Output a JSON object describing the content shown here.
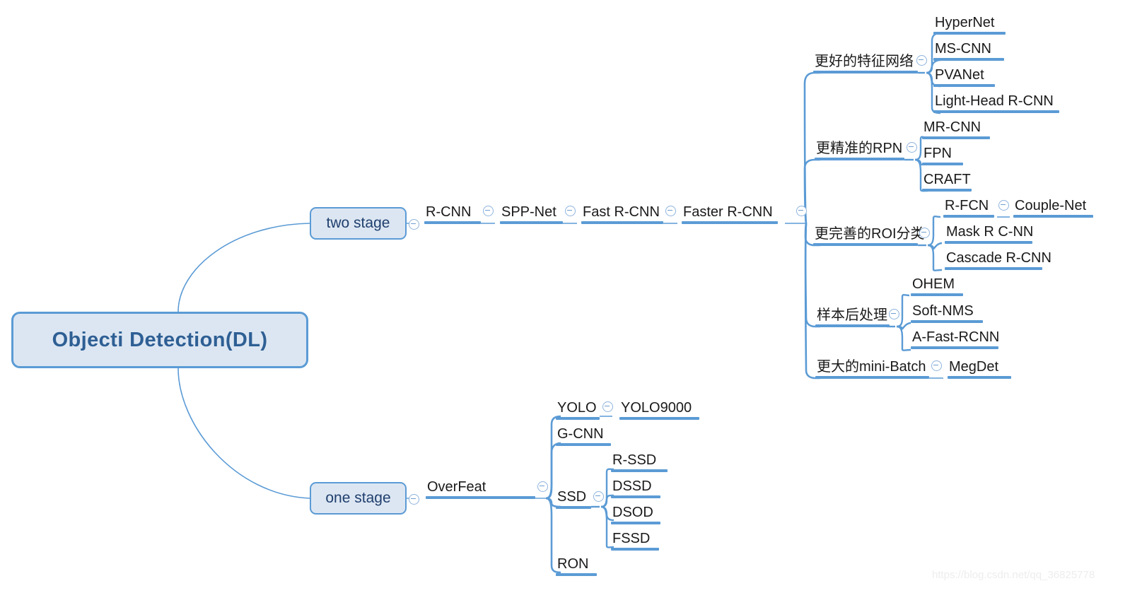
{
  "meta": {
    "colors": {
      "branch_line": "#5b9bd5",
      "node_fill": "#dce6f2",
      "node_border": "#5b9bd5",
      "root_text": "#2e5f94",
      "stage_text": "#1f3f6e",
      "topic_text": "#1a1a1a",
      "collapse_icon": "#8fb4dd",
      "watermark": "#ededed"
    },
    "watermark": "https://blog.csdn.net/qq_36825778"
  },
  "root": {
    "label": "Objecti Detection(DL)"
  },
  "branches": {
    "two_stage": {
      "label": "two stage",
      "chain": [
        {
          "label": "R-CNN"
        },
        {
          "label": "SPP-Net"
        },
        {
          "label": "Fast R-CNN"
        },
        {
          "label": "Faster R-CNN"
        }
      ],
      "groups": [
        {
          "label": "更好的特征网络",
          "children": [
            {
              "label": "HyperNet"
            },
            {
              "label": "MS-CNN"
            },
            {
              "label": "PVANet"
            },
            {
              "label": "Light-Head R-CNN"
            }
          ]
        },
        {
          "label": "更精准的RPN",
          "children": [
            {
              "label": "MR-CNN"
            },
            {
              "label": "FPN"
            },
            {
              "label": "CRAFT"
            }
          ]
        },
        {
          "label": "更完善的ROI分类",
          "children": [
            {
              "label": "R-FCN",
              "next": "Couple-Net"
            },
            {
              "label": "Mask R C-NN"
            },
            {
              "label": "Cascade R-CNN"
            }
          ]
        },
        {
          "label": "样本后处理",
          "children": [
            {
              "label": "OHEM"
            },
            {
              "label": "Soft-NMS"
            },
            {
              "label": "A-Fast-RCNN"
            }
          ]
        },
        {
          "label": "更大的mini-Batch",
          "children": [
            {
              "label": "MegDet"
            }
          ]
        }
      ]
    },
    "one_stage": {
      "label": "one stage",
      "chain": [
        {
          "label": "OverFeat"
        }
      ],
      "children": [
        {
          "label": "YOLO",
          "next": "YOLO9000"
        },
        {
          "label": "G-CNN"
        },
        {
          "label": "SSD",
          "children": [
            {
              "label": "R-SSD"
            },
            {
              "label": "DSSD"
            },
            {
              "label": "DSOD"
            },
            {
              "label": "FSSD"
            }
          ]
        },
        {
          "label": "RON"
        }
      ]
    }
  }
}
